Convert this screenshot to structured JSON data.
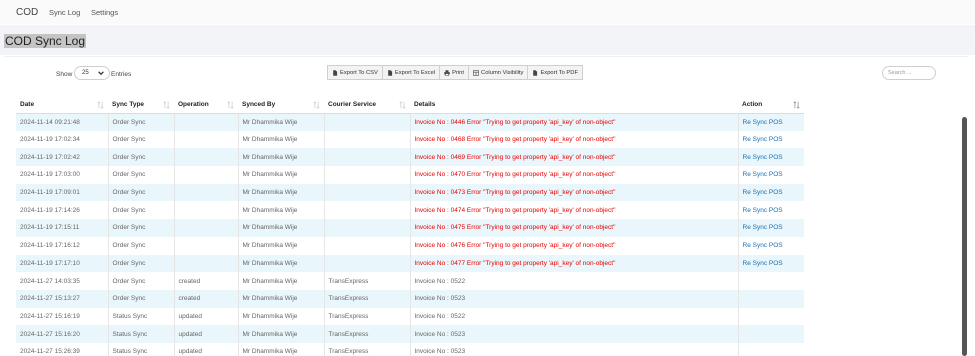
{
  "nav": {
    "brand": "COD",
    "links": [
      "Sync Log",
      "Settings"
    ]
  },
  "page": {
    "title": "COD Sync Log"
  },
  "controls": {
    "show_label": "Show",
    "entries_value": "25",
    "entries_label": "Entries",
    "export_buttons": [
      "Export To CSV",
      "Export To Excel",
      "Print",
      "Column Visibility",
      "Export To PDF"
    ],
    "search_placeholder": "Search ..."
  },
  "table": {
    "columns": [
      "Date",
      "Sync Type",
      "Operation",
      "Synced By",
      "Courier Service",
      "Details",
      "Action"
    ],
    "rows": [
      {
        "date": "2024-11-14 09:21:48",
        "sync_type": "Order Sync",
        "operation": "",
        "synced_by": "Mr Dhammika Wije",
        "courier": "",
        "details": "Invoice No : 0446 Error \"Trying to get property 'api_key' of non-object\"",
        "status": "error",
        "action": "Re Sync POS"
      },
      {
        "date": "2024-11-19 17:02:34",
        "sync_type": "Order Sync",
        "operation": "",
        "synced_by": "Mr Dhammika Wije",
        "courier": "",
        "details": "Invoice No : 0468 Error \"Trying to get property 'api_key' of non-object\"",
        "status": "error",
        "action": "Re Sync POS"
      },
      {
        "date": "2024-11-19 17:02:42",
        "sync_type": "Order Sync",
        "operation": "",
        "synced_by": "Mr Dhammika Wije",
        "courier": "",
        "details": "Invoice No : 0469 Error \"Trying to get property 'api_key' of non-object\"",
        "status": "error",
        "action": "Re Sync POS"
      },
      {
        "date": "2024-11-19 17:03:00",
        "sync_type": "Order Sync",
        "operation": "",
        "synced_by": "Mr Dhammika Wije",
        "courier": "",
        "details": "Invoice No : 0470 Error \"Trying to get property 'api_key' of non-object\"",
        "status": "error",
        "action": "Re Sync POS"
      },
      {
        "date": "2024-11-19 17:09:01",
        "sync_type": "Order Sync",
        "operation": "",
        "synced_by": "Mr Dhammika Wije",
        "courier": "",
        "details": "Invoice No : 0473 Error \"Trying to get property 'api_key' of non-object\"",
        "status": "error",
        "action": "Re Sync POS"
      },
      {
        "date": "2024-11-19 17:14:26",
        "sync_type": "Order Sync",
        "operation": "",
        "synced_by": "Mr Dhammika Wije",
        "courier": "",
        "details": "Invoice No : 0474 Error \"Trying to get property 'api_key' of non-object\"",
        "status": "error",
        "action": "Re Sync POS"
      },
      {
        "date": "2024-11-19 17:15:11",
        "sync_type": "Order Sync",
        "operation": "",
        "synced_by": "Mr Dhammika Wije",
        "courier": "",
        "details": "Invoice No : 0475 Error \"Trying to get property 'api_key' of non-object\"",
        "status": "error",
        "action": "Re Sync POS"
      },
      {
        "date": "2024-11-19 17:16:12",
        "sync_type": "Order Sync",
        "operation": "",
        "synced_by": "Mr Dhammika Wije",
        "courier": "",
        "details": "Invoice No : 0476 Error \"Trying to get property 'api_key' of non-object\"",
        "status": "error",
        "action": "Re Sync POS"
      },
      {
        "date": "2024-11-19 17:17:10",
        "sync_type": "Order Sync",
        "operation": "",
        "synced_by": "Mr Dhammika Wije",
        "courier": "",
        "details": "Invoice No : 0477 Error \"Trying to get property 'api_key' of non-object\"",
        "status": "error",
        "action": "Re Sync POS"
      },
      {
        "date": "2024-11-27 14:03:35",
        "sync_type": "Order Sync",
        "operation": "created",
        "synced_by": "Mr Dhammika Wije",
        "courier": "TransExpress",
        "details": "Invoice No : 0522",
        "status": "ok",
        "action": ""
      },
      {
        "date": "2024-11-27 15:13:27",
        "sync_type": "Order Sync",
        "operation": "created",
        "synced_by": "Mr Dhammika Wije",
        "courier": "TransExpress",
        "details": "Invoice No : 0523",
        "status": "ok",
        "action": ""
      },
      {
        "date": "2024-11-27 15:16:19",
        "sync_type": "Status Sync",
        "operation": "updated",
        "synced_by": "Mr Dhammika Wije",
        "courier": "TransExpress",
        "details": "Invoice No : 0522",
        "status": "ok",
        "action": ""
      },
      {
        "date": "2024-11-27 15:16:20",
        "sync_type": "Status Sync",
        "operation": "updated",
        "synced_by": "Mr Dhammika Wije",
        "courier": "TransExpress",
        "details": "Invoice No : 0523",
        "status": "ok",
        "action": ""
      },
      {
        "date": "2024-11-27 15:26:39",
        "sync_type": "Status Sync",
        "operation": "updated",
        "synced_by": "Mr Dhammika Wije",
        "courier": "TransExpress",
        "details": "Invoice No : 0523",
        "status": "ok",
        "action": ""
      }
    ]
  },
  "colors": {
    "error_text": "#e60000",
    "action_link": "#1b6fb3",
    "row_stripe": "#e9f6fb"
  },
  "icons": {
    "export_buttons": [
      "file-icon",
      "file-icon",
      "print-icon",
      "table-icon",
      "file-icon"
    ],
    "entries_select": "chevron-down-icon",
    "column_sort": "sort-icon"
  }
}
